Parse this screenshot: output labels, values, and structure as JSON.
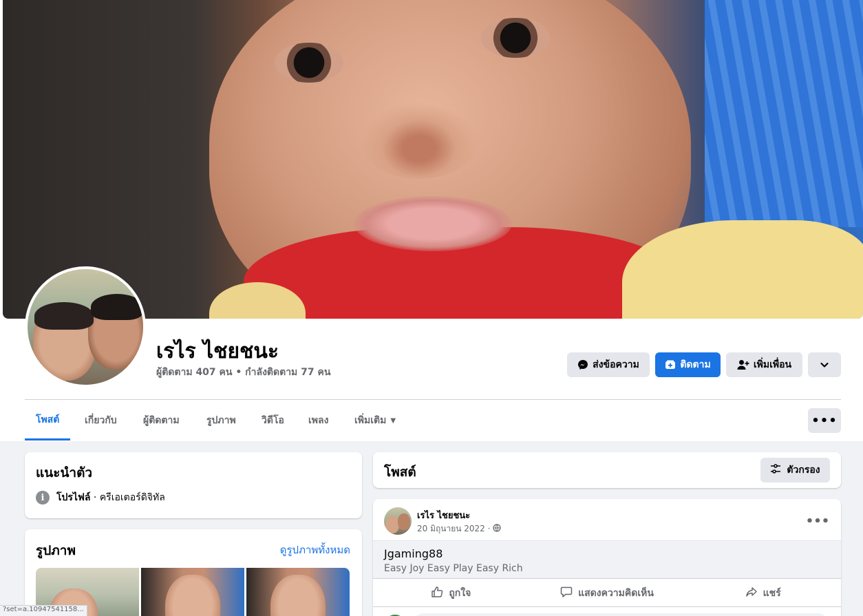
{
  "profile": {
    "name": "เรไร ไชยชนะ",
    "stats": "ผู้ติดตาม 407 คน • กำลังติดตาม 77 คน"
  },
  "actions": {
    "message": "ส่งข้อความ",
    "follow": "ติดตาม",
    "add_friend": "เพิ่มเพื่อน"
  },
  "tabs": [
    {
      "label": "โพสต์",
      "active": true
    },
    {
      "label": "เกี่ยวกับ"
    },
    {
      "label": "ผู้ติดตาม"
    },
    {
      "label": "รูปภาพ"
    },
    {
      "label": "วิดีโอ"
    },
    {
      "label": "เพลง"
    },
    {
      "label": "เพิ่มเติม"
    }
  ],
  "intro": {
    "title": "แนะนำตัว",
    "profile_label": "โปรไฟล์",
    "profile_category": " · ครีเอเตอร์ดิจิทัล"
  },
  "photos": {
    "title": "รูปภาพ",
    "see_all": "ดูรูปภาพทั้งหมด"
  },
  "posts": {
    "title": "โพสต์",
    "filter_label": "ตัวกรอง"
  },
  "post": {
    "author": "เรไร ไชยชนะ",
    "date": "20 มิถุนายน 2022 ·",
    "link_title": "Jgaming88",
    "link_desc": "Easy Joy Easy Play Easy Rich",
    "like": "ถูกใจ",
    "comment": "แสดงความคิดเห็น",
    "share": "แชร์"
  },
  "status_bar": {
    "url": "?set=a.10947541158..."
  },
  "colors": {
    "accent": "#1b74e4",
    "button_grey": "#e4e6eb",
    "background": "#f0f2f5",
    "secondary_text": "#65676b"
  },
  "icons": [
    "messenger-icon",
    "follow-icon",
    "add-friend-icon",
    "chevron-down-icon",
    "more-dots-icon",
    "info-icon",
    "filter-icon",
    "globe-icon",
    "like-icon",
    "comment-icon",
    "share-icon"
  ]
}
